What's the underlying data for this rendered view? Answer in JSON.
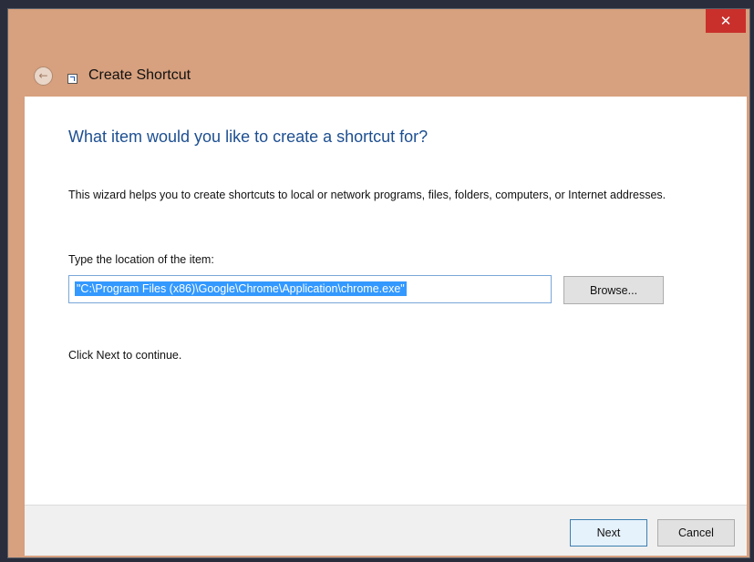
{
  "window": {
    "title": "Create Shortcut",
    "close_glyph": "✕",
    "back_glyph": "←"
  },
  "content": {
    "heading": "What item would you like to create a shortcut for?",
    "description": "This wizard helps you to create shortcuts to local or network programs, files, folders, computers, or Internet addresses.",
    "location_label": "Type the location of the item:",
    "location_value": "\"C:\\Program Files (x86)\\Google\\Chrome\\Application\\chrome.exe\"",
    "browse_label": "Browse...",
    "continue_text": "Click Next to continue."
  },
  "footer": {
    "next_label": "Next",
    "cancel_label": "Cancel"
  },
  "colors": {
    "window_chrome": "#d7a07e",
    "close_button": "#c9302c",
    "heading_blue": "#1d4f91",
    "selection": "#3399ff"
  },
  "icons": [
    "close-icon",
    "back-arrow-icon",
    "shortcut-icon"
  ]
}
